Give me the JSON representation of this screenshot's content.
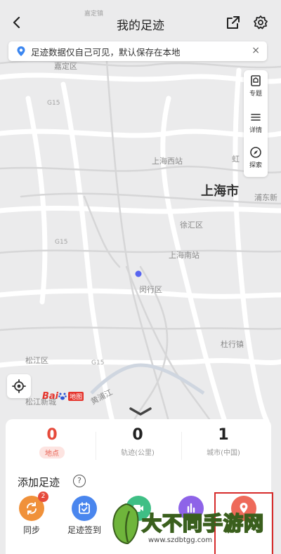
{
  "header": {
    "title": "我的足迹"
  },
  "notice": {
    "text": "足迹数据仅自己可见，默认保存在本地",
    "close": "×"
  },
  "tools": [
    {
      "label": "专题"
    },
    {
      "label": "详情"
    },
    {
      "label": "探索"
    }
  ],
  "map_labels": {
    "top_clip": "嘉定镇",
    "jiading": "嘉定区",
    "shanghai_west": "上海西站",
    "hong": "虹",
    "city": "上海市",
    "pudong": "浦东新",
    "xuhui": "徐汇区",
    "shanghai_south": "上海南站",
    "minhang": "闵行区",
    "songjiang": "松江区",
    "songjiang_clip": "松江新城",
    "huangpujiang": "黄浦江",
    "zhuqiao": "杜行镇",
    "g15": "G15",
    "g15b": "G15",
    "g15c": "G15"
  },
  "logo": {
    "bai": "Bai",
    "map": "地图"
  },
  "stats": [
    {
      "value": "0",
      "label": "地点"
    },
    {
      "value": "0",
      "label": "轨迹(公里)"
    },
    {
      "value": "1",
      "label": "城市(中国)"
    }
  ],
  "section": {
    "title": "添加足迹",
    "help": "?"
  },
  "actions": [
    {
      "label": "同步",
      "badge": "2",
      "color": "#f0913a"
    },
    {
      "label": "足迹签到",
      "color": "#4a86ee"
    },
    {
      "label": "",
      "color": "#3fbf85"
    },
    {
      "label": "",
      "color": "#8e63e8"
    },
    {
      "label": "",
      "color": "#ee6a5a"
    }
  ],
  "watermark": {
    "text": "大不同手游网",
    "url": "www.szdbtgg.com"
  },
  "colors": {
    "accent_red": "#e64a3b",
    "location_dot": "#5865f0"
  }
}
